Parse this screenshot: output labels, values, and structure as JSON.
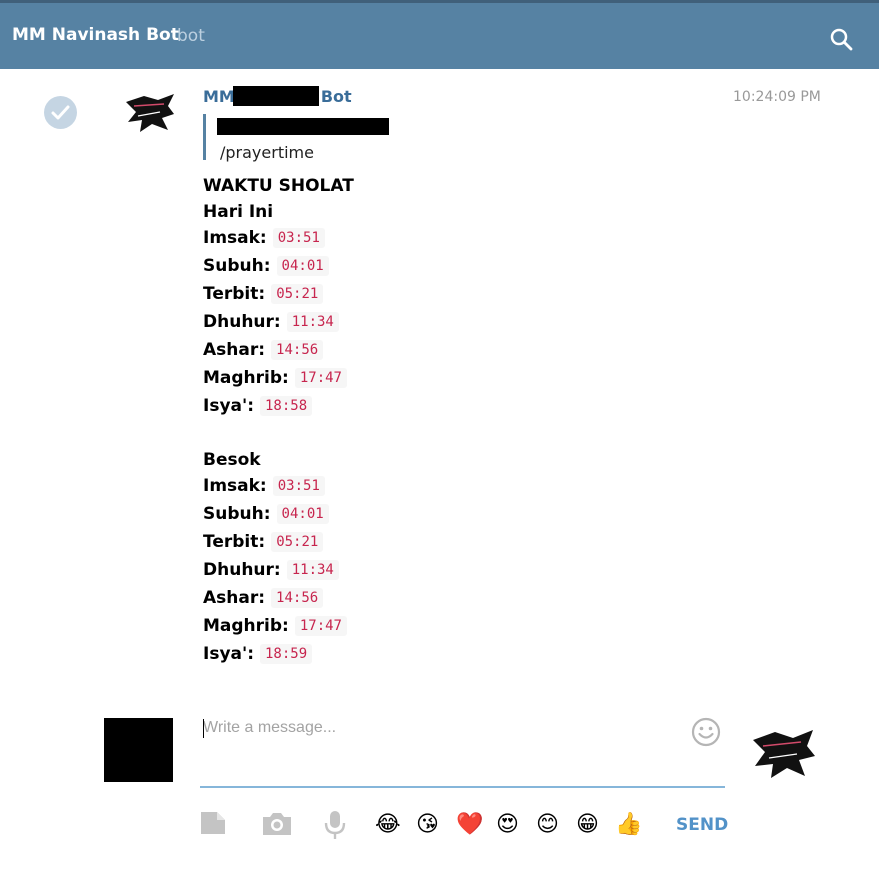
{
  "header": {
    "title": "MM Navinash Bot",
    "subtitle": "bot"
  },
  "message": {
    "author_prefix": "MM",
    "author_suffix": "Bot",
    "time": "10:24:09 PM",
    "reply_text": "/prayertime",
    "title": "WAKTU SHOLAT",
    "today": {
      "heading": "Hari Ini",
      "rows": [
        {
          "label": "Imsak:",
          "time": "03:51"
        },
        {
          "label": "Subuh:",
          "time": "04:01"
        },
        {
          "label": "Terbit:",
          "time": "05:21"
        },
        {
          "label": "Dhuhur:",
          "time": "11:34"
        },
        {
          "label": "Ashar:",
          "time": "14:56"
        },
        {
          "label": "Maghrib:",
          "time": "17:47"
        },
        {
          "label": "Isya':",
          "time": "18:58"
        }
      ]
    },
    "tomorrow": {
      "heading": "Besok",
      "rows": [
        {
          "label": "Imsak:",
          "time": "03:51"
        },
        {
          "label": "Subuh:",
          "time": "04:01"
        },
        {
          "label": "Terbit:",
          "time": "05:21"
        },
        {
          "label": "Dhuhur:",
          "time": "11:34"
        },
        {
          "label": "Ashar:",
          "time": "14:56"
        },
        {
          "label": "Maghrib:",
          "time": "17:47"
        },
        {
          "label": "Isya':",
          "time": "18:59"
        }
      ]
    }
  },
  "composer": {
    "placeholder": "Write a message...",
    "value": "",
    "send_label": "SEND",
    "emojis": [
      "😂",
      "😘",
      "❤️",
      "😍",
      "😊",
      "😁",
      "👍"
    ]
  },
  "icons": {
    "search": "search-icon",
    "check": "check-icon",
    "document": "document-icon",
    "camera": "camera-icon",
    "microphone": "microphone-icon",
    "smiley": "smiley-icon"
  },
  "colors": {
    "header_bg": "#5682a3",
    "author": "#3a6d99",
    "code_text": "#c7254e",
    "send": "#5292c8"
  }
}
